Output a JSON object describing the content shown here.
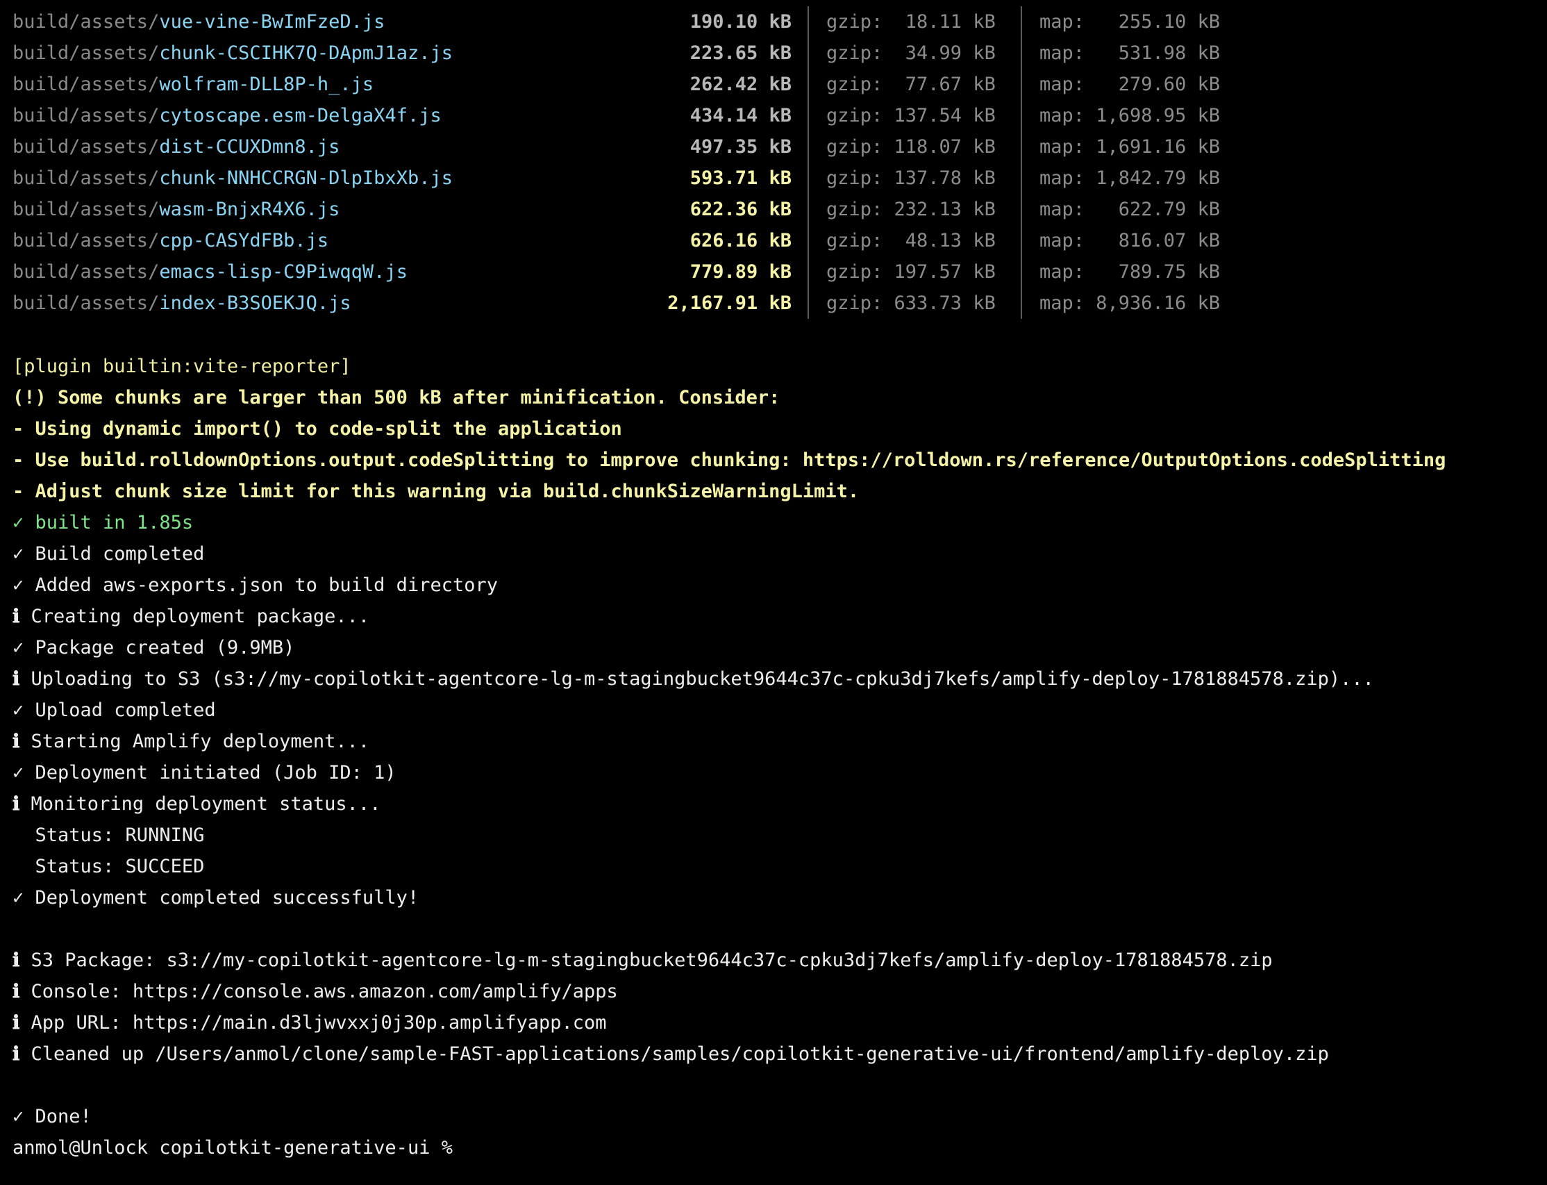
{
  "theme": {
    "background": "#000000",
    "text": "#ededed",
    "path_dir": "#8a8a8a",
    "path_file": "#8ad4f4",
    "warning": "#f7f3a6",
    "success": "#7ee787",
    "separator": "#5a5a5a"
  },
  "assets": [
    {
      "dir": "build/assets/",
      "file": "vue-vine-BwImFzeD.js",
      "size": "190.10 kB",
      "gzip": "gzip:  18.11 kB",
      "map": "map:   255.10 kB",
      "warn": false
    },
    {
      "dir": "build/assets/",
      "file": "chunk-CSCIHK7Q-DApmJ1az.js",
      "size": "223.65 kB",
      "gzip": "gzip:  34.99 kB",
      "map": "map:   531.98 kB",
      "warn": false
    },
    {
      "dir": "build/assets/",
      "file": "wolfram-DLL8P-h_.js",
      "size": "262.42 kB",
      "gzip": "gzip:  77.67 kB",
      "map": "map:   279.60 kB",
      "warn": false
    },
    {
      "dir": "build/assets/",
      "file": "cytoscape.esm-DelgaX4f.js",
      "size": "434.14 kB",
      "gzip": "gzip: 137.54 kB",
      "map": "map: 1,698.95 kB",
      "warn": false
    },
    {
      "dir": "build/assets/",
      "file": "dist-CCUXDmn8.js",
      "size": "497.35 kB",
      "gzip": "gzip: 118.07 kB",
      "map": "map: 1,691.16 kB",
      "warn": false
    },
    {
      "dir": "build/assets/",
      "file": "chunk-NNHCCRGN-DlpIbxXb.js",
      "size": "593.71 kB",
      "gzip": "gzip: 137.78 kB",
      "map": "map: 1,842.79 kB",
      "warn": true
    },
    {
      "dir": "build/assets/",
      "file": "wasm-BnjxR4X6.js",
      "size": "622.36 kB",
      "gzip": "gzip: 232.13 kB",
      "map": "map:   622.79 kB",
      "warn": true
    },
    {
      "dir": "build/assets/",
      "file": "cpp-CASYdFBb.js",
      "size": "626.16 kB",
      "gzip": "gzip:  48.13 kB",
      "map": "map:   816.07 kB",
      "warn": true
    },
    {
      "dir": "build/assets/",
      "file": "emacs-lisp-C9PiwqqW.js",
      "size": "779.89 kB",
      "gzip": "gzip: 197.57 kB",
      "map": "map:   789.75 kB",
      "warn": true
    },
    {
      "dir": "build/assets/",
      "file": "index-B3SOEKJQ.js",
      "size": "2,167.91 kB",
      "gzip": "gzip: 633.73 kB",
      "map": "map: 8,936.16 kB",
      "warn": true
    }
  ],
  "reporter": {
    "plugin": "[plugin builtin:vite-reporter]",
    "warning": "(!) Some chunks are larger than 500 kB after minification. Consider:",
    "tips": [
      "- Using dynamic import() to code-split the application",
      "- Use build.rolldownOptions.output.codeSplitting to improve chunking: https://rolldown.rs/reference/OutputOptions.codeSplitting",
      "- Adjust chunk size limit for this warning via build.chunkSizeWarningLimit."
    ],
    "built": "✓ built in 1.85s"
  },
  "log": {
    "build_completed": "✓ Build completed",
    "added_exports": "✓ Added aws-exports.json to build directory",
    "creating_package": "Creating deployment package...",
    "package_created": "✓ Package created (9.9MB)",
    "uploading": "Uploading to S3 (s3://my-copilotkit-agentcore-lg-m-stagingbucket9644c37c-cpku3dj7kefs/amplify-deploy-1781884578.zip)...",
    "upload_completed": "✓ Upload completed",
    "starting_amplify": "Starting Amplify deployment...",
    "deployment_initiated": "✓ Deployment initiated (Job ID: 1)",
    "monitoring": "Monitoring deployment status...",
    "status_running": "  Status: RUNNING",
    "status_succeed": "  Status: SUCCEED",
    "deployment_completed": "✓ Deployment completed successfully!",
    "s3_package": "S3 Package: s3://my-copilotkit-agentcore-lg-m-stagingbucket9644c37c-cpku3dj7kefs/amplify-deploy-1781884578.zip",
    "console": "Console: https://console.aws.amazon.com/amplify/apps",
    "app_url": "App URL: https://main.d3ljwvxxj0j30p.amplifyapp.com",
    "cleaned_up": "Cleaned up /Users/anmol/clone/sample-FAST-applications/samples/copilotkit-generative-ui/frontend/amplify-deploy.zip",
    "done": "✓ Done!"
  },
  "prompt": "anmol@Unlock copilotkit-generative-ui % ",
  "info_glyph": "ℹ"
}
